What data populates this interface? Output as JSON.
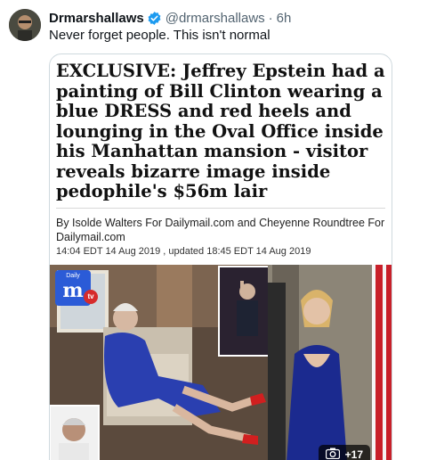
{
  "tweet": {
    "display_name": "Drmarshallaws",
    "handle": "@drmarshallaws",
    "separator": "·",
    "time": "6h",
    "text": "Never forget people. This isn't normal"
  },
  "article": {
    "headline": "EXCLUSIVE: Jeffrey Epstein had a painting of Bill Clinton wearing a blue DRESS and red heels and lounging in the Oval Office inside his Manhattan mansion - visitor reveals bizarre image inside pedophile's $56m lair",
    "byline": "By Isolde Walters For Dailymail.com and Cheyenne Roundtree For Dailymail.com",
    "dates": "14:04 EDT 14 Aug 2019 , updated 18:45 EDT 14 Aug 2019",
    "logo_text": "Daily",
    "logo_letter": "m",
    "logo_tv": "tv",
    "media_count": "+17"
  },
  "colors": {
    "verified": "#1d9bf0",
    "logo_blue": "#2b5bd7",
    "logo_red": "#d62b2b",
    "dress_blue": "#2a3fb0",
    "heels_red": "#d11f1f"
  },
  "icons": [
    "verified-badge-icon",
    "camera-icon"
  ]
}
